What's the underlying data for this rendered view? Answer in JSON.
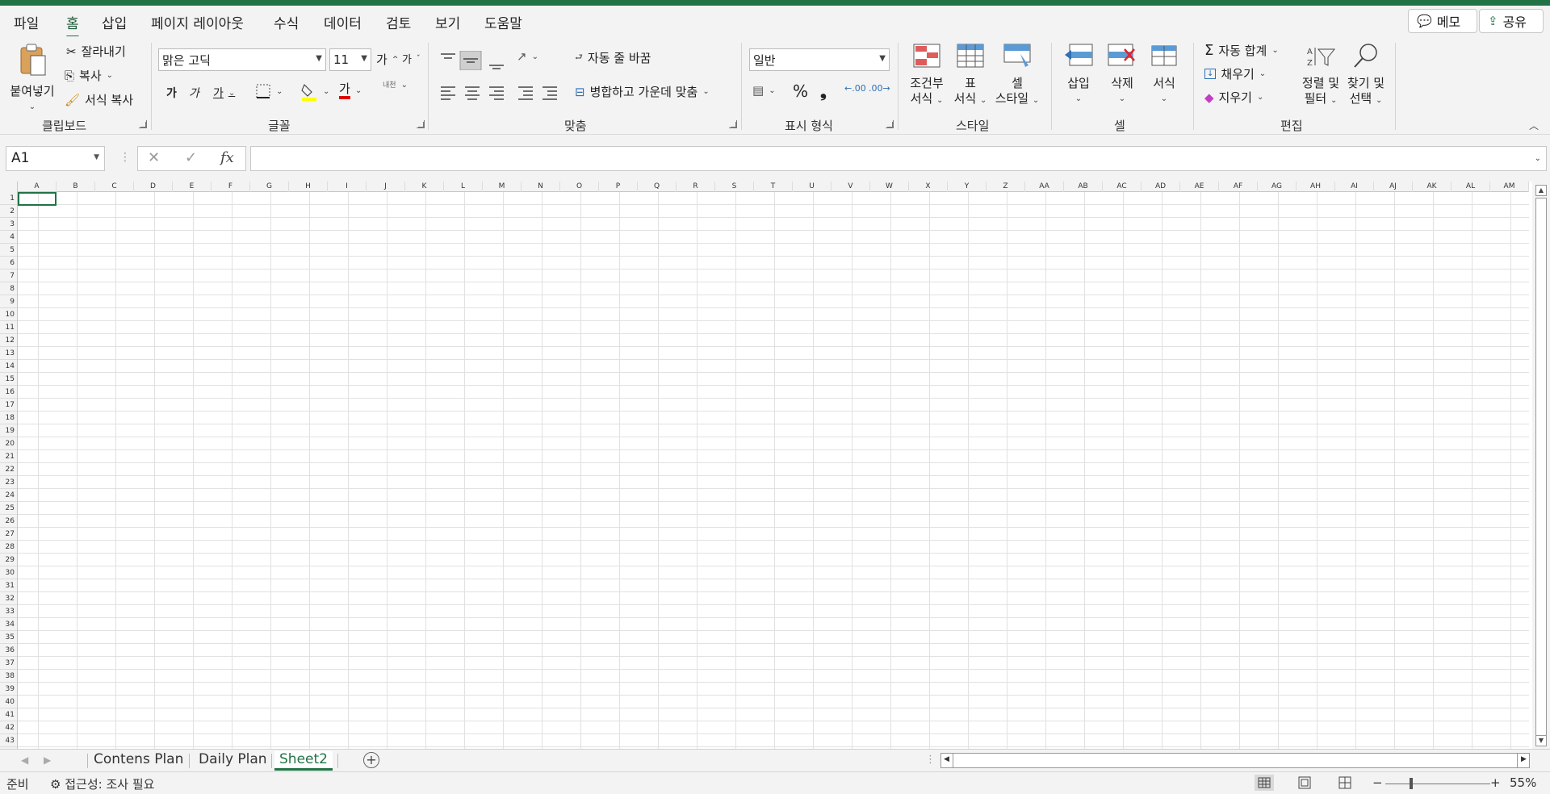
{
  "app": {
    "accent": "#217346"
  },
  "tabs": [
    {
      "label": "파일"
    },
    {
      "label": "홈"
    },
    {
      "label": "삽입"
    },
    {
      "label": "페이지 레이아웃"
    },
    {
      "label": "수식"
    },
    {
      "label": "데이터"
    },
    {
      "label": "검토"
    },
    {
      "label": "보기"
    },
    {
      "label": "도움말"
    }
  ],
  "top_buttons": {
    "memo": "메모",
    "share": "공유"
  },
  "clipboard": {
    "paste": "붙여넣기",
    "cut": "잘라내기",
    "copy": "복사",
    "format_painter": "서식 복사",
    "group": "클립보드"
  },
  "font": {
    "name": "맑은 고딕",
    "size": "11",
    "grow": "가",
    "shrink": "가",
    "bold": "가",
    "italic": "가",
    "underline": "가",
    "font_color_glyph": "가",
    "phonetic": "내천",
    "group": "글꼴"
  },
  "alignment": {
    "wrap": "자동 줄 바꿈",
    "merge": "병합하고 가운데 맞춤",
    "group": "맞춤"
  },
  "number": {
    "format": "일반",
    "percent": "%",
    "comma": "❟",
    "group": "표시 형식"
  },
  "styles": {
    "conditional": [
      "조건부",
      "서식"
    ],
    "table": [
      "표",
      "서식"
    ],
    "cell": [
      "셀",
      "스타일"
    ],
    "group": "스타일"
  },
  "cells_group": {
    "insert": "삽입",
    "delete": "삭제",
    "format": "서식",
    "group": "셀"
  },
  "editing": {
    "autosum": "자동 합계",
    "fill": "채우기",
    "clear": "지우기",
    "sort": [
      "정렬 및",
      "필터"
    ],
    "find": [
      "찾기 및",
      "선택"
    ],
    "group": "편집"
  },
  "formula_bar": {
    "name_box": "A1",
    "fx": "fx",
    "cancel": "✕",
    "enter": "✓",
    "content": ""
  },
  "columns": [
    "A",
    "B",
    "C",
    "D",
    "E",
    "F",
    "G",
    "H",
    "I",
    "J",
    "K",
    "L",
    "M",
    "N",
    "O",
    "P",
    "Q",
    "R",
    "S",
    "T",
    "U",
    "V",
    "W",
    "X",
    "Y",
    "Z",
    "AA",
    "AB",
    "AC",
    "AD",
    "AE",
    "AF",
    "AG",
    "AH",
    "AI",
    "AJ",
    "AK",
    "AL",
    "AM"
  ],
  "rows": [
    "1",
    "2",
    "3",
    "4",
    "5",
    "6",
    "7",
    "8",
    "9",
    "10",
    "11",
    "12",
    "13",
    "14",
    "15",
    "16",
    "17",
    "18",
    "19",
    "20",
    "21",
    "22",
    "23",
    "24",
    "25",
    "26",
    "27",
    "28",
    "29",
    "30",
    "31",
    "32",
    "33",
    "34",
    "35",
    "36",
    "37",
    "38",
    "39",
    "40",
    "41",
    "42",
    "43"
  ],
  "sheets": [
    {
      "name": "Contens Plan",
      "active": false
    },
    {
      "name": "Daily Plan",
      "active": false
    },
    {
      "name": "Sheet2",
      "active": true
    }
  ],
  "status": {
    "ready": "준비",
    "accessibility": "접근성: 조사 필요",
    "zoom": "55%"
  }
}
